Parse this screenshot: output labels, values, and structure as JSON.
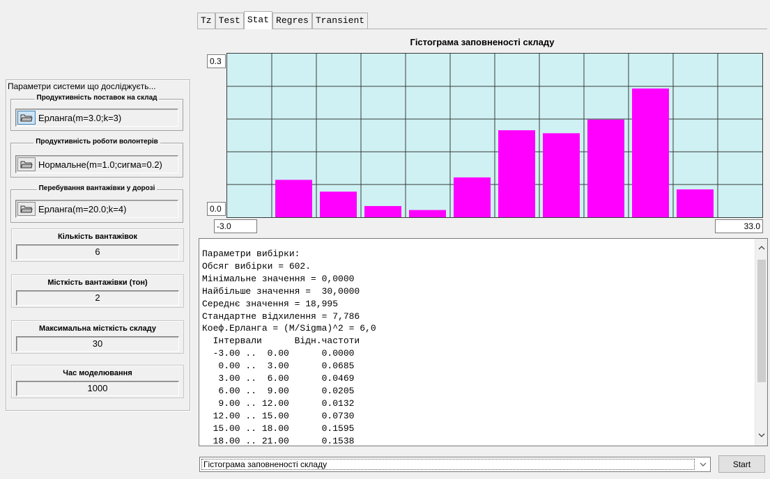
{
  "tabs": [
    {
      "label": "Tz",
      "active": false
    },
    {
      "label": "Test",
      "active": false
    },
    {
      "label": "Stat",
      "active": true
    },
    {
      "label": "Regres",
      "active": false
    },
    {
      "label": "Transient",
      "active": false
    }
  ],
  "left_panel": {
    "title": "Параметри системи що досліджуєть...",
    "params": [
      {
        "label": "Продуктивність поставок на склад",
        "value": "Ерланга(m=3.0;k=3)",
        "icon": "folder-icon",
        "active": true
      },
      {
        "label": "Продуктивність роботи волонтерів",
        "value": "Нормальне(m=1.0;сигма=0.2)",
        "icon": "folder-icon",
        "active": false
      },
      {
        "label": "Перебування вантажівки у дорозі",
        "value": "Ерланга(m=20.0;k=4)",
        "icon": "folder-icon",
        "active": false
      }
    ],
    "numbers": [
      {
        "label": "Кількість вантажівок",
        "value": "6"
      },
      {
        "label": "Місткість вантажівки (тон)",
        "value": "2"
      },
      {
        "label": "Максимальна місткість складу",
        "value": "30"
      },
      {
        "label": "Час моделювання",
        "value": "1000"
      }
    ]
  },
  "chart_data": {
    "type": "bar",
    "title": "Гістограма заповненості складу",
    "x_min_label": "-3.0",
    "x_max_label": "33.0",
    "y_max_label": "0.3",
    "y_min_label": "0.0",
    "xlim": [
      -3,
      33
    ],
    "ylim": [
      0,
      0.3
    ],
    "categories": [
      "-3.00 .. 0.00",
      "0.00 .. 3.00",
      "3.00 .. 6.00",
      "6.00 .. 9.00",
      "9.00 .. 12.00",
      "12.00 .. 15.00",
      "15.00 .. 18.00",
      "18.00 .. 21.00",
      "21.00 .. 24.00",
      "24.00 .. 27.00",
      "27.00 .. 30.00",
      "30.00 .. 33.00"
    ],
    "values": [
      0.0,
      0.0685,
      0.0469,
      0.0205,
      0.0132,
      0.073,
      0.1595,
      0.154,
      0.179,
      0.236,
      0.051,
      0.0
    ],
    "bar_color": "#ff00ff",
    "plot_background": "#cff1f3",
    "grid": true,
    "grid_cols": 12,
    "grid_rows": 5
  },
  "output_text": [
    "Параметри вибірки:",
    "Обсяг вибірки = 602.",
    "Мінімальне значення = 0,0000",
    "Найбільше значення =  30,0000",
    "Середнє значення = 18,995",
    "Стандартне відхилення = 7,786",
    "Коеф.Ерланга = (M/Sigma)^2 = 6,0",
    "  Інтервали      Відн.частоти",
    "  -3.00 ..  0.00      0.0000",
    "   0.00 ..  3.00      0.0685",
    "   3.00 ..  6.00      0.0469",
    "   6.00 ..  9.00      0.0205",
    "   9.00 .. 12.00      0.0132",
    "  12.00 .. 15.00      0.0730",
    "  15.00 .. 18.00      0.1595",
    "  18.00 .. 21.00      0.1538"
  ],
  "bottom": {
    "select_value": "Гістограма заповненості складу",
    "start_label": "Start"
  }
}
